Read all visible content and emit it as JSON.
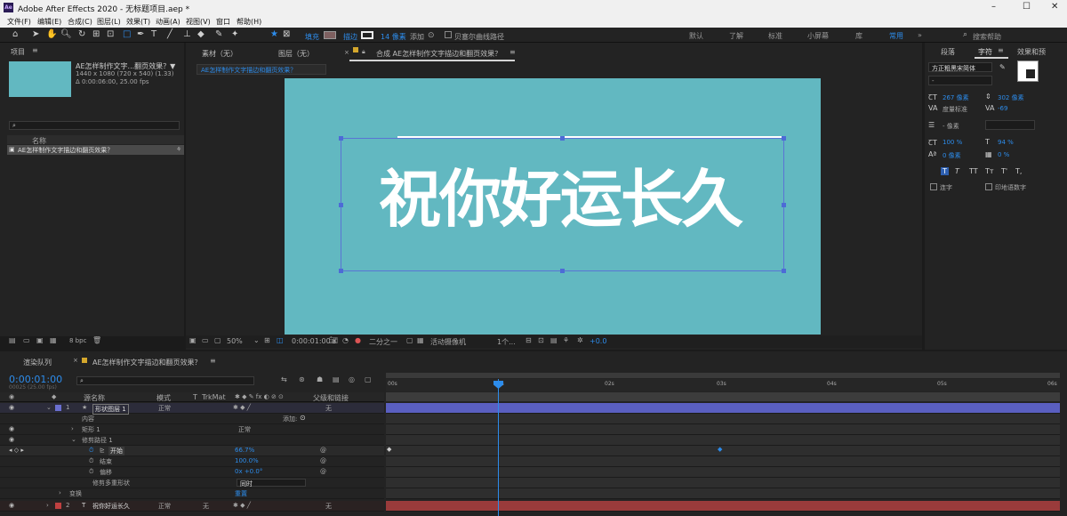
{
  "app": {
    "title": "Adobe After Effects 2020 - 无标题项目.aep *",
    "logo_text": "Ae",
    "win_min": "–",
    "win_max": "☐",
    "win_close": "✕"
  },
  "menu": [
    "文件(F)",
    "编辑(E)",
    "合成(C)",
    "图层(L)",
    "效果(T)",
    "动画(A)",
    "视图(V)",
    "窗口",
    "帮助(H)"
  ],
  "toolbar": {
    "fill_label": "填充",
    "stroke_label": "描边",
    "stroke_size": "14 像素",
    "add_label": "添加",
    "bezier_label": "贝塞尔曲线路径"
  },
  "workspaces": [
    "默认",
    "了解",
    "标准",
    "小屏幕",
    "库",
    "常用"
  ],
  "search_help": "搜索帮助",
  "project": {
    "tab": "项目",
    "comp_name": "AE怎样制作文字...翻页效果？▼",
    "comp_info1": "1440 x 1080 (720 x 540) (1.33)",
    "comp_info2": "Δ 0:00:06:00, 25.00 fps",
    "col_name": "名称",
    "item": "AE怎样制作文字描边和翻页效果？",
    "bpc": "8 bpc"
  },
  "viewer": {
    "tab_footage": "素材（无）",
    "tab_layer": "图层（无）",
    "tab_comp": "合成 AE怎样制作文字描边和翻页效果？",
    "breadcrumb": "AE怎样制作文字描边和翻页效果？",
    "canvas_text": "祝你好运长久",
    "zoom": "50%",
    "timecode": "0:00:01:00",
    "resolution": "二分之一",
    "camera": "活动摄像机",
    "views": "1个...",
    "exposure": "+0.0"
  },
  "right": {
    "tabs": [
      "段落",
      "字符",
      "效果和预"
    ],
    "font": "方正粗黑宋简体",
    "font_style": "-",
    "size": "267 像素",
    "leading": "302 像素",
    "kerning": "度量标准",
    "tracking": "-69",
    "stroke_width": "- 像素",
    "vscale": "100 %",
    "hscale": "94 %",
    "baseline": "0 像素",
    "tsume": "0 %",
    "styles": [
      "T",
      "T",
      "TT",
      "Tт",
      "T'",
      "T,"
    ],
    "ligature": "连字",
    "hindi": "印地语数字"
  },
  "timeline": {
    "tab_render": "渲染队列",
    "tab_comp": "AE怎样制作文字描边和翻页效果？",
    "timecode": "0:00:01:00",
    "timecode_sub": "00025 (25.00 fps)",
    "cols": [
      "源名称",
      "模式",
      "T",
      "TrkMat",
      "父级和链接"
    ],
    "rows": [
      {
        "num": "1",
        "name": "形状图层 1",
        "mode": "正常",
        "parent": "无"
      },
      {
        "name": "内容",
        "extra": "添加:"
      },
      {
        "name": "矩形 1",
        "mode": "正常"
      },
      {
        "name": "修剪路径 1"
      },
      {
        "name": "开始",
        "value": "66.7%"
      },
      {
        "name": "结束",
        "value": "100.0%"
      },
      {
        "name": "偏移",
        "value": "0x +0.0°"
      },
      {
        "name": "修剪多重形状",
        "value": "同时"
      },
      {
        "name": "变换",
        "value": "重置"
      },
      {
        "num": "2",
        "name": "祝你好运长久",
        "mode": "正常",
        "trk": "无",
        "parent": "无"
      }
    ],
    "ruler": [
      "00s",
      "01s",
      "02s",
      "03s",
      "04s",
      "05s",
      "06s"
    ]
  },
  "colors": {
    "accent": "#2d8ceb",
    "canvas": "#62b8c1",
    "layer1": "#6a6fd0",
    "layer2": "#a04040"
  }
}
